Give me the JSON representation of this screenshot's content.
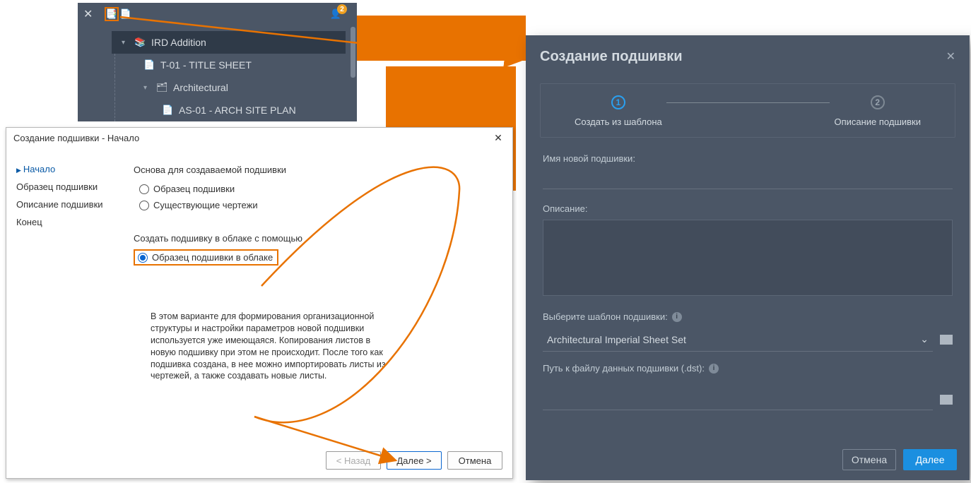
{
  "ssm": {
    "close_glyph": "✕",
    "tools": {
      "new_sheet": "📑",
      "second": "📄",
      "account": "👤",
      "badge": "2"
    },
    "tree": {
      "root": "IRD Addition",
      "n1": "T-01 - TITLE SHEET",
      "n2": "Architectural",
      "n3": "AS-01 - ARCH SITE PLAN"
    }
  },
  "wizard": {
    "title": "Создание подшивки - Начало",
    "nav": {
      "n1": "Начало",
      "n2": "Образец подшивки",
      "n3": "Описание подшивки",
      "n4": "Конец"
    },
    "grp1_label": "Основа для создаваемой подшивки",
    "r1": "Образец подшивки",
    "r2": "Существующие чертежи",
    "grp2_label": "Создать подшивку в облаке с помощью",
    "r3": "Образец подшивки в облаке",
    "desc": "В этом варианте для формирования организационной структуры и настройки параметров новой подшивки используется уже имеющаяся. Копирования листов в новую подшивку при этом не происходит. После того как подшивка создана, в нее можно импортировать листы из чертежей, а также создавать новые листы.",
    "back": "< Назад",
    "next": "Далее >",
    "cancel": "Отмена"
  },
  "modal": {
    "title": "Создание подшивки",
    "step1": "Создать из шаблона",
    "step2": "Описание подшивки",
    "name_label": "Имя новой подшивки:",
    "desc_label": "Описание:",
    "tpl_label": "Выберите шаблон подшивки:",
    "tpl_value": "Architectural Imperial Sheet Set",
    "path_label": "Путь к файлу данных подшивки (.dst):",
    "cancel": "Отмена",
    "next": "Далее",
    "step1_num": "1",
    "step2_num": "2"
  }
}
